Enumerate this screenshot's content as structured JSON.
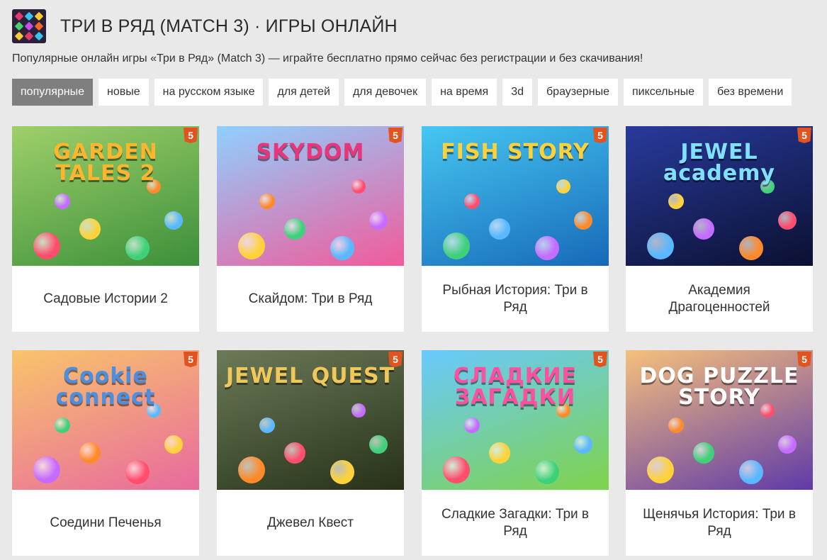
{
  "header": {
    "title": "ТРИ В РЯД (MATCH 3) · ИГРЫ ОНЛАЙН",
    "subtitle": "Популярные онлайн игры «Три в Ряд» (Match 3) — играйте бесплатно прямо сейчас без регистрации и без скачивания!",
    "logo_icon": "match3-gems-logo"
  },
  "tags": [
    {
      "label": "популярные",
      "active": true
    },
    {
      "label": "новые"
    },
    {
      "label": "на русском языке"
    },
    {
      "label": "для детей"
    },
    {
      "label": "для девочек"
    },
    {
      "label": "на время"
    },
    {
      "label": "3d"
    },
    {
      "label": "браузерные"
    },
    {
      "label": "пиксельные"
    },
    {
      "label": "без времени"
    }
  ],
  "html5_badge": "5",
  "games": [
    {
      "label": "Садовые Истории 2",
      "thumb_text": "GARDEN TALES 2",
      "colors": [
        "#9ed06a",
        "#3c8f3a"
      ],
      "text_color": "#ffb52e"
    },
    {
      "label": "Скайдом: Три в Ряд",
      "thumb_text": "SKYDOM",
      "colors": [
        "#8fd0ff",
        "#f25a9a"
      ],
      "text_color": "#e9367a"
    },
    {
      "label": "Рыбная История: Три в Ряд",
      "thumb_text": "FISH STORY",
      "colors": [
        "#46c7f2",
        "#1769b8"
      ],
      "text_color": "#ffd23a"
    },
    {
      "label": "Академия Драгоценностей",
      "thumb_text": "JEWEL academy",
      "colors": [
        "#283a9c",
        "#0b1030"
      ],
      "text_color": "#7fe0ff"
    },
    {
      "label": "Соедини Печенья",
      "thumb_text": "Cookie connect",
      "colors": [
        "#f9c46b",
        "#e86a9e"
      ],
      "text_color": "#4a90e2"
    },
    {
      "label": "Джевел Квест",
      "thumb_text": "JEWEL QUEST",
      "colors": [
        "#6c7a58",
        "#263118"
      ],
      "text_color": "#f0c85a"
    },
    {
      "label": "Сладкие Загадки: Три в Ряд",
      "thumb_text": "СЛАДКИЕ ЗАГАДКИ",
      "colors": [
        "#69c9ff",
        "#7fd34b"
      ],
      "text_color": "#ff4fa1"
    },
    {
      "label": "Щенячья История: Три в Ряд",
      "thumb_text": "DOG PUZZLE STORY",
      "colors": [
        "#f6c07c",
        "#5f3aa8"
      ],
      "text_color": "#ffffff"
    }
  ]
}
